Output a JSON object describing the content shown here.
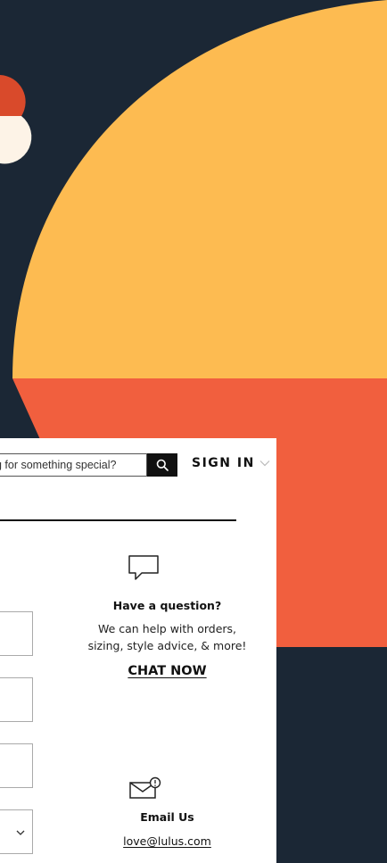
{
  "colors": {
    "background_navy": "#1b2735",
    "accent_yellow": "#fdbb51",
    "accent_orange": "#f15f3e",
    "accent_red": "#d94a2b",
    "cream": "#fdf3e7",
    "card_white": "#ffffff",
    "text_dark": "#111111"
  },
  "header": {
    "search": {
      "placeholder": "g for something special?",
      "icon": "search-icon"
    },
    "sign_in": {
      "label": "SIGN IN",
      "icon": "chevron-down-icon"
    }
  },
  "form": {
    "select_icon": "chevron-down-icon"
  },
  "help": {
    "chat": {
      "icon": "chat-bubble-icon",
      "title": "Have a question?",
      "body_line1": "We can help with orders,",
      "body_line2": "sizing, style advice, & more!",
      "cta": "CHAT NOW"
    },
    "email": {
      "icon": "mail-icon",
      "title": "Email Us",
      "address": "love@lulus.com"
    }
  }
}
